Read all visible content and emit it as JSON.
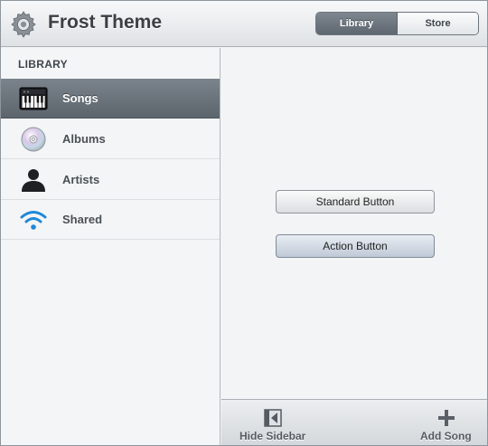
{
  "header": {
    "title": "Frost Theme",
    "segments": [
      {
        "label": "Library",
        "active": true
      },
      {
        "label": "Store",
        "active": false
      }
    ]
  },
  "sidebar": {
    "section_title": "LIBRARY",
    "items": [
      {
        "label": "Songs",
        "icon": "piano-keyboard-icon",
        "selected": true
      },
      {
        "label": "Albums",
        "icon": "cd-disc-icon",
        "selected": false
      },
      {
        "label": "Artists",
        "icon": "person-silhouette-icon",
        "selected": false
      },
      {
        "label": "Shared",
        "icon": "wifi-icon",
        "selected": false
      }
    ]
  },
  "main": {
    "standard_button": "Standard Button",
    "action_button": "Action Button"
  },
  "toolbar": {
    "hide_sidebar": "Hide Sidebar",
    "add_song": "Add Song"
  },
  "colors": {
    "selected_row": "#6b737b",
    "action_button": "#c7d0dc",
    "accent_blue": "#1e88d8"
  }
}
